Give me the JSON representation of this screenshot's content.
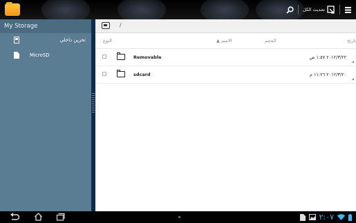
{
  "topbar": {
    "refresh_label": "تحديث الكل",
    "icons": [
      "folder-app-icon",
      "search-icon",
      "select-all-icon",
      "menu-icon"
    ]
  },
  "sidebar": {
    "header": "My Storage",
    "items": [
      {
        "label": "تخزين داخلي",
        "icon": "sdcard-icon"
      },
      {
        "label": "MicroSD",
        "icon": "microsd-icon"
      }
    ]
  },
  "path": {
    "separator": "/"
  },
  "columns": {
    "type": "النوع",
    "name": "الاسم",
    "size": "الحجم",
    "date": "تاريخ"
  },
  "files": [
    {
      "name": "Removable",
      "date": "٢٠١٢/٣/٢٢ ١:٥٧ ص"
    },
    {
      "name": "sdcard",
      "date": "٢٠١٢/٣/٢٠ ١١:٢٦ م"
    }
  ],
  "statusbar": {
    "time": "٢:٠٧",
    "icons": [
      "back-icon",
      "home-icon",
      "recent-apps-icon",
      "sd-notification-icon",
      "image-notification-icon",
      "wifi-icon",
      "battery-icon"
    ]
  }
}
